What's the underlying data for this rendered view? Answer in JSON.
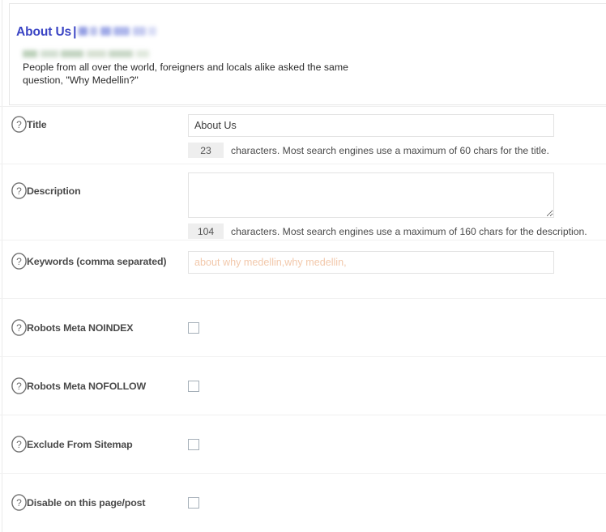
{
  "preview": {
    "title": "About Us",
    "title_separator": "|",
    "site_name_redacted": "",
    "url_redacted": "",
    "snippet": "People from all over the world, foreigners and locals alike asked the same question, \"Why Medellin?\""
  },
  "colors": {
    "preview_title": "#3a44c4",
    "snippet_text": "#2b2b2b",
    "placeholder": "#f2c8ab",
    "checkbox_border": "#a5afb8",
    "counter_bg": "#eeeeee",
    "input_border": "#e2e2e2",
    "row_divider": "#f0f0f0"
  },
  "icons": {
    "help": "?"
  },
  "fields": {
    "title": {
      "label": "Title",
      "value": "About Us",
      "placeholder": "",
      "count": "23",
      "note": "characters. Most search engines use a maximum of 60 chars for the title."
    },
    "description": {
      "label": "Description",
      "value": "",
      "placeholder": "",
      "count": "104",
      "note": "characters. Most search engines use a maximum of 160 chars for the description."
    },
    "keywords": {
      "label": "Keywords (comma separated)",
      "value": "",
      "placeholder": "about why medellin,why medellin,"
    }
  },
  "checkboxes": [
    {
      "label": "Robots Meta NOINDEX",
      "checked": false
    },
    {
      "label": "Robots Meta NOFOLLOW",
      "checked": false
    },
    {
      "label": "Exclude From Sitemap",
      "checked": false
    },
    {
      "label": "Disable on this page/post",
      "checked": false
    }
  ]
}
